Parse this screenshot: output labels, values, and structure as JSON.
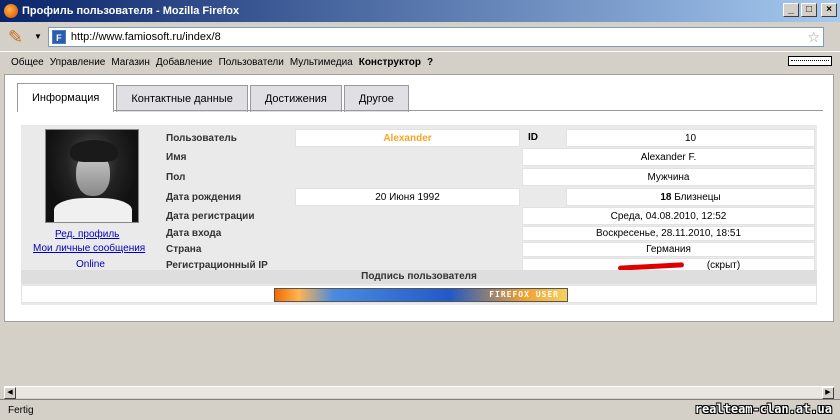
{
  "window": {
    "title": "Профиль пользователя - Mozilla Firefox",
    "buttons": {
      "minimize": "_",
      "maximize": "□",
      "close": "×"
    }
  },
  "navbar": {
    "url": "http://www.famiosoft.ru/index/8",
    "favicon_letter": "F"
  },
  "menu": {
    "items": [
      "Общее",
      "Управление",
      "Магазин",
      "Добавление",
      "Пользователи",
      "Мультимедиа",
      "Конструктор",
      "?"
    ],
    "bold_index": 6
  },
  "tabs": [
    {
      "label": "Информация",
      "active": true
    },
    {
      "label": "Контактные данные",
      "active": false
    },
    {
      "label": "Достижения",
      "active": false
    },
    {
      "label": "Другое",
      "active": false
    }
  ],
  "profile": {
    "edit_profile_link": "Ред. профиль",
    "messages_link": "Мои личные сообщения",
    "online_status": "Online",
    "user_label": "Пользователь",
    "username": "Alexander",
    "id_label": "ID",
    "id_value": "10",
    "name_label": "Имя",
    "name_value": "Alexander F.",
    "gender_label": "Пол",
    "gender_value": "Мужчина",
    "birth_label": "Дата рождения",
    "birth_value": "20 Июня 1992",
    "zodiac_num": "18",
    "zodiac_sign": "Близнецы",
    "reg_label": "Дата регистрации",
    "reg_value": "Среда, 04.08.2010, 12:52",
    "login_label": "Дата входа",
    "login_value": "Воскресенье, 28.11.2010, 18:51",
    "country_label": "Страна",
    "country_value": "Германия",
    "ip_label": "Регистрационный IP",
    "ip_hidden": "(скрыт)",
    "signature_title": "Подпись пользователя",
    "banner_text": "FIREFOX USER"
  },
  "status": {
    "text": "Fertig",
    "watermark": "realteam-clan.at.ua"
  },
  "colors": {
    "username": "#f5a623",
    "link": "#0000c0",
    "redaction": "#e00000"
  }
}
